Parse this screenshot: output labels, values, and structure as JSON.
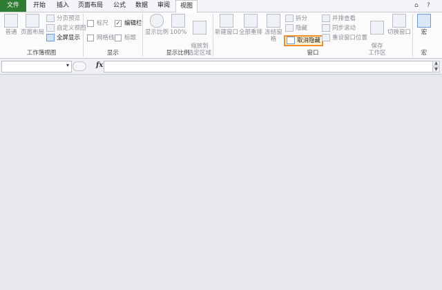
{
  "tabs": [
    "文件",
    "开始",
    "插入",
    "页面布局",
    "公式",
    "数据",
    "审阅",
    "视图"
  ],
  "window_controls": [
    "⌂",
    "?"
  ],
  "groups": {
    "workbook_views": {
      "label": "工作簿视图",
      "normal": "普通",
      "page_layout": "页面布局",
      "page_break_preview": "分页预览",
      "custom_views": "自定义视图",
      "full_screen": "全屏显示"
    },
    "show": {
      "label": "显示",
      "ruler": "标尺",
      "formula_bar": "编辑栏",
      "gridlines": "网格线",
      "headings": "标题"
    },
    "zoom": {
      "label": "显示比例",
      "zoom": "显示比例",
      "hundred": "100%",
      "zoom_selection": "缩放到\n选定区域"
    },
    "window": {
      "label": "窗口",
      "new_window": "新建窗口",
      "arrange_all": "全部重排",
      "freeze_panes": "冻结窗格",
      "split": "拆分",
      "hide": "隐藏",
      "unhide": "取消隐藏",
      "side_by_side": "并排查看",
      "sync_scroll": "同步滚动",
      "reset_position": "重设窗口位置",
      "save_workspace": "保存\n工作区",
      "switch_windows": "切换窗口"
    },
    "macros": {
      "label": "宏",
      "macros": "宏"
    }
  },
  "formula_bar": {
    "fx_label": "fx",
    "name_box_value": "",
    "formula_value": ""
  }
}
